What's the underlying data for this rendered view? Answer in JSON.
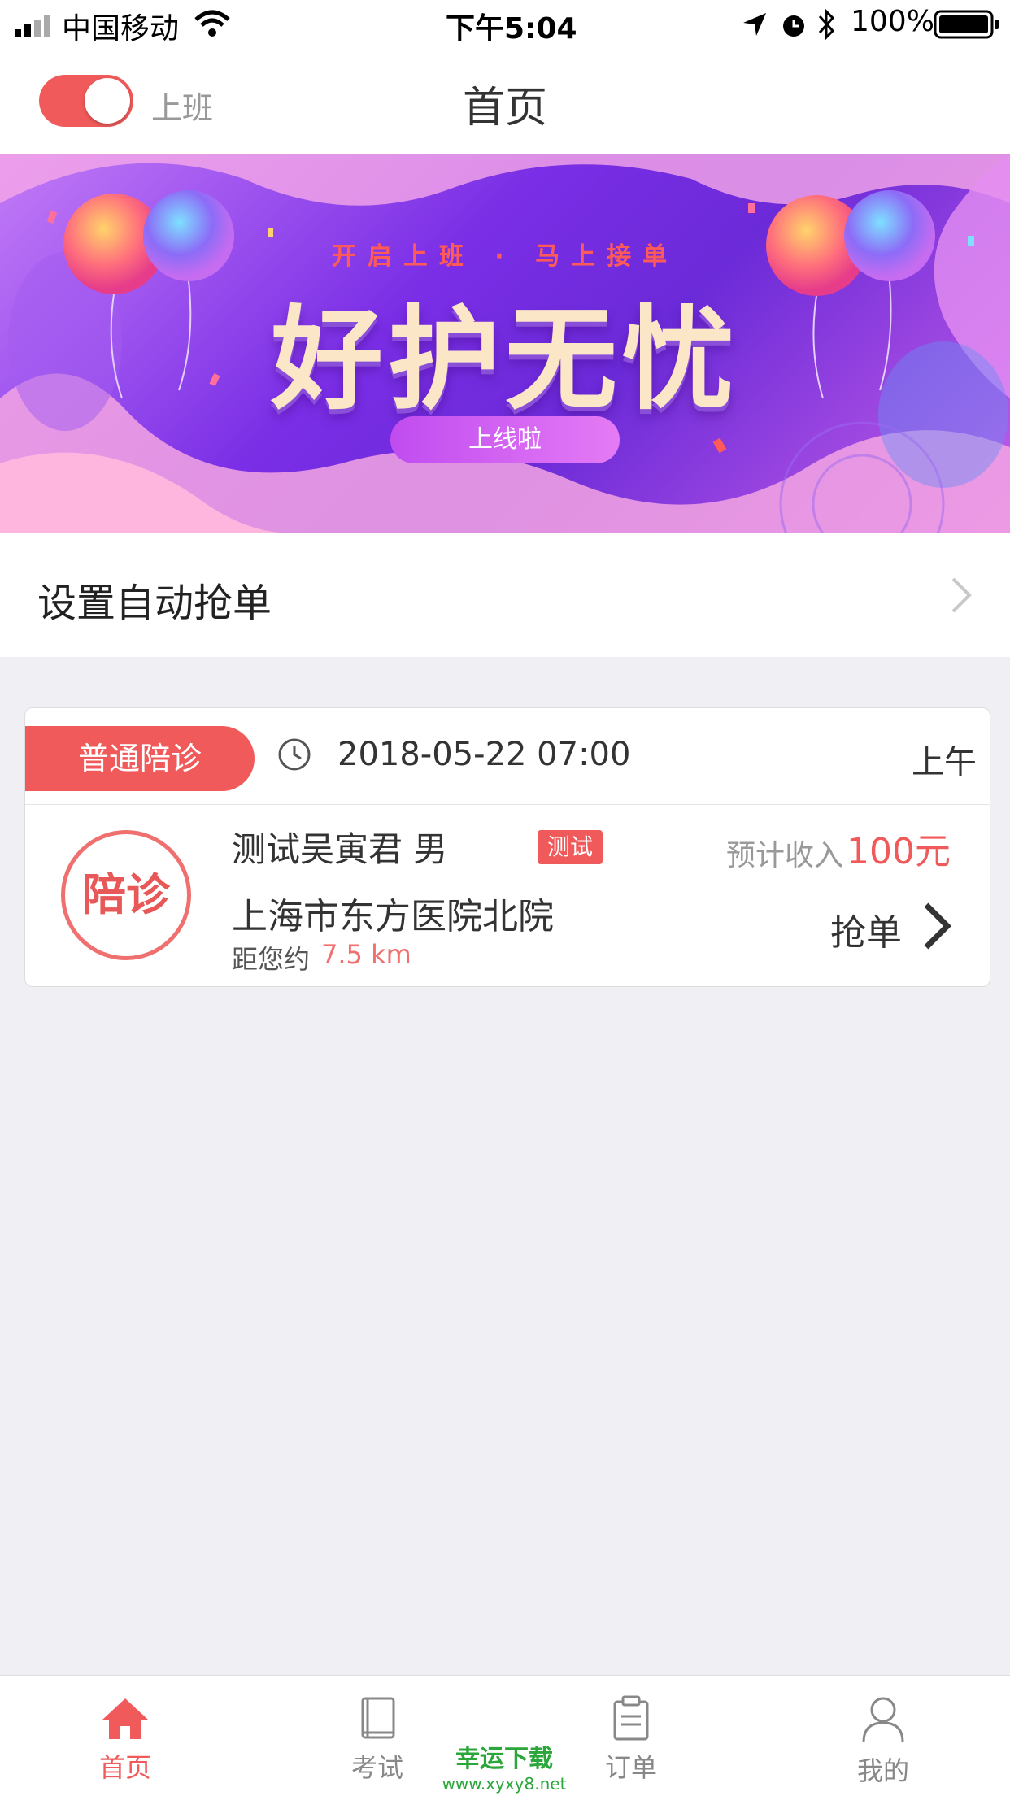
{
  "status_bar": {
    "carrier": "中国移动",
    "time": "下午5:04",
    "battery": "100%",
    "icons": [
      "signal-icon",
      "wifi-icon",
      "location-icon",
      "alarm-icon",
      "bluetooth-icon",
      "battery-icon"
    ]
  },
  "header": {
    "toggle_label": "上班",
    "toggle_on": true,
    "title": "首页"
  },
  "banner": {
    "tagline": "开启上班 · 马上接单",
    "title": "好护无忧",
    "button": "上线啦"
  },
  "auto_grab": {
    "label": "设置自动抢单"
  },
  "order": {
    "tag": "普通陪诊",
    "time": "2018-05-22 07:00",
    "period": "上午",
    "stamp": "陪诊",
    "patient": "测试吴寅君  男",
    "badge": "测试",
    "income_label": "预计收入",
    "income_amount": "100元",
    "hospital": "上海市东方医院北院",
    "distance_label": "距您约",
    "distance_value": "7.5 km",
    "action": "抢单"
  },
  "tab_bar": {
    "tabs": [
      {
        "label": "首页",
        "icon": "home-icon",
        "active": true
      },
      {
        "label": "考试",
        "icon": "book-icon",
        "active": false
      },
      {
        "label": "订单",
        "icon": "clipboard-icon",
        "active": false
      },
      {
        "label": "我的",
        "icon": "user-icon",
        "active": false
      }
    ]
  },
  "watermark": {
    "title": "幸运下载",
    "url": "www.xyxy8.net"
  },
  "colors": {
    "accent": "#f15a5a",
    "background": "#efeff4",
    "banner_purple": "#7a2ee6"
  }
}
